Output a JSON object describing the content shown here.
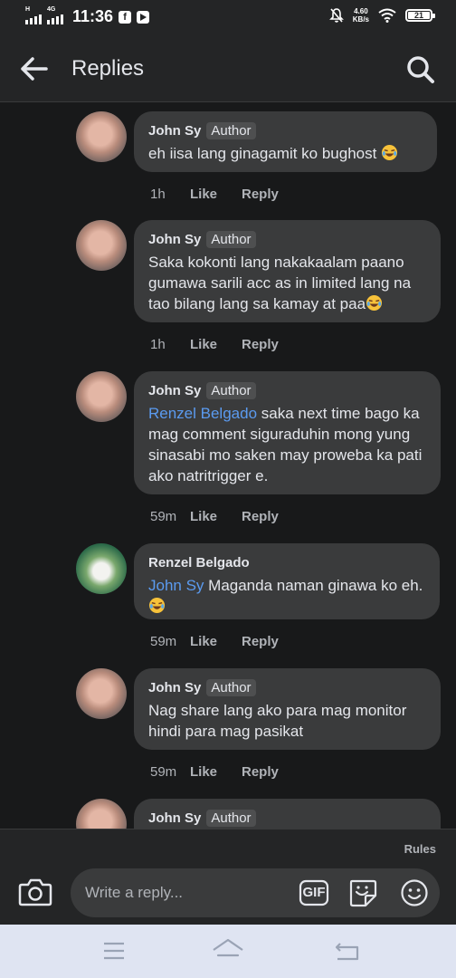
{
  "status_bar": {
    "signal_label": "H",
    "network_label": "4G",
    "time": "11:36",
    "app_icons": [
      "facebook-icon",
      "youtube-icon"
    ],
    "speed_value": "4.60",
    "speed_unit": "KB/s",
    "battery": "21"
  },
  "header": {
    "title": "Replies",
    "back_icon": "arrow-left-icon",
    "search_icon": "search-icon"
  },
  "comments": [
    {
      "author": "John Sy",
      "badge": "Author",
      "text": "eh iisa lang ginagamit ko bughost",
      "emoji": "rofl-emoji",
      "time": "1h",
      "like": "Like",
      "reply": "Reply"
    },
    {
      "author": "John Sy",
      "badge": "Author",
      "text": "Saka kokonti lang nakakaalam paano gumawa sarili acc as in limited lang na tao bilang lang sa kamay at paa",
      "emoji": "rofl-emoji",
      "time": "1h",
      "like": "Like",
      "reply": "Reply"
    },
    {
      "author": "John Sy",
      "badge": "Author",
      "mention": "Renzel Belgado",
      "text": " saka next time bago ka mag comment siguraduhin mong yung sinasabi mo saken may proweba ka pati ako natritrigger e.",
      "time": "59m",
      "like": "Like",
      "reply": "Reply"
    },
    {
      "author": "Renzel Belgado",
      "mention": "John Sy",
      "text": " Maganda naman ginawa ko eh. ",
      "emoji": "rofl-emoji",
      "time": "59m",
      "like": "Like",
      "reply": "Reply"
    },
    {
      "author": "John Sy",
      "badge": "Author",
      "text": "Nag share lang ako para mag monitor hindi para mag pasikat",
      "time": "59m",
      "like": "Like",
      "reply": "Reply"
    },
    {
      "author": "John Sy",
      "badge": "Author"
    }
  ],
  "composer": {
    "rules_label": "Rules",
    "placeholder": "Write a reply...",
    "gif_label": "GIF"
  },
  "colors": {
    "background": "#18191a",
    "bubble": "#3a3b3c",
    "mention": "#5b9bf0",
    "secondary_text": "#b0b3b8",
    "nav_bar": "#dfe4f2"
  }
}
